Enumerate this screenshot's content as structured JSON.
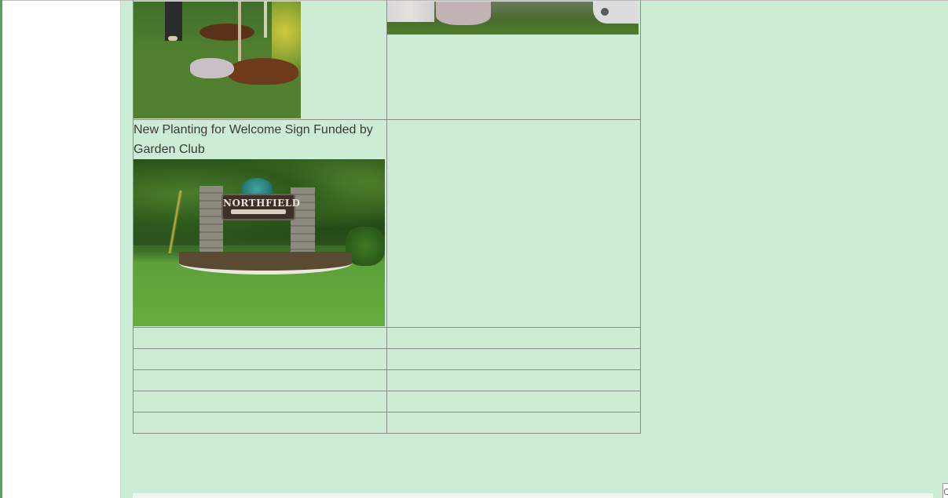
{
  "gallery": {
    "rows": [
      {
        "cells": [
          {
            "caption": "",
            "photo": "tree-planting-photo"
          },
          {
            "caption": "",
            "photo": "volunteers-group-photo"
          }
        ]
      },
      {
        "cells": [
          {
            "caption": " New Planting for Welcome Sign Funded by Garden Club",
            "photo": "welcome-sign-photo"
          },
          {
            "caption": "",
            "photo": ""
          }
        ]
      }
    ],
    "empty_rows": 5
  },
  "welcome_sign": {
    "board_text": "NORTHFIELD"
  },
  "colors": {
    "content_background": "#cdecd5",
    "sidebar_background": "#ffffff",
    "left_edge": "#5f9a5f",
    "table_border": "#8c8c8c",
    "caption_text": "#3a3a3a"
  }
}
